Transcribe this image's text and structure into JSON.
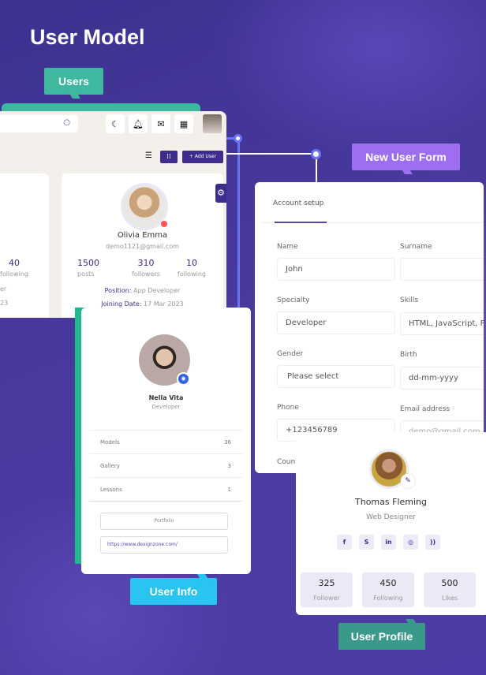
{
  "title": "User Model",
  "tags": {
    "users": "Users",
    "new_user_form": "New User Form",
    "user_info": "User Info",
    "user_profile": "User Profile"
  },
  "colors": {
    "background": "#4a3a9e",
    "accent": "#3e2d8c",
    "users_tag": "#3fb8a0",
    "form_tag": "#9d6ff0",
    "info_tag": "#29c4f0",
    "profile_tag": "#3a9a8a"
  },
  "users_panel": {
    "header_icons": [
      "search-icon",
      "moon-icon",
      "bell-icon",
      "inbox-icon",
      "calendar-icon"
    ],
    "add_user": "+ Add User",
    "partial_card": {
      "following_count": "40",
      "following_label": "following",
      "line1": "er",
      "line2": "23"
    },
    "card": {
      "name": "Olivia Emma",
      "email": "demo1121@gmail.com",
      "stats": [
        {
          "value": "1500",
          "label": "posts"
        },
        {
          "value": "310",
          "label": "followers"
        },
        {
          "value": "10",
          "label": "following"
        }
      ],
      "position_label": "Position:",
      "position": "App Developer",
      "joining_label": "Joining Date:",
      "joining": "17 Mar 2023"
    }
  },
  "form": {
    "tab": "Account setup",
    "fields": [
      {
        "label": "Name",
        "value": "John"
      },
      {
        "label": "Surname",
        "value": ""
      },
      {
        "label": "Specialty",
        "value": "Developer"
      },
      {
        "label": "Skills",
        "value": "HTML,  JavaScript,  P"
      },
      {
        "label": "Gender",
        "value": "Please select"
      },
      {
        "label": "Birth",
        "value": "dd-mm-yyyy"
      },
      {
        "label": "Phone",
        "value": "+123456789"
      },
      {
        "label": "Email address",
        "value": "demo@gmail.com"
      },
      {
        "label": "Country",
        "value": ""
      }
    ]
  },
  "user_info": {
    "name": "Nella Vita",
    "role": "Developer",
    "rows": [
      {
        "label": "Models",
        "value": "36"
      },
      {
        "label": "Gallery",
        "value": "3"
      },
      {
        "label": "Lessons",
        "value": "1"
      }
    ],
    "portfolio": "Portfolio",
    "url": "https://www.dexignzone.com/"
  },
  "user_profile": {
    "name": "Thomas Fleming",
    "role": "Web Designer",
    "social": [
      "f",
      "S",
      "in",
      "◎",
      "))"
    ],
    "stats": [
      {
        "value": "325",
        "label": "Follower"
      },
      {
        "value": "450",
        "label": "Following"
      },
      {
        "value": "500",
        "label": "Likes"
      }
    ]
  }
}
